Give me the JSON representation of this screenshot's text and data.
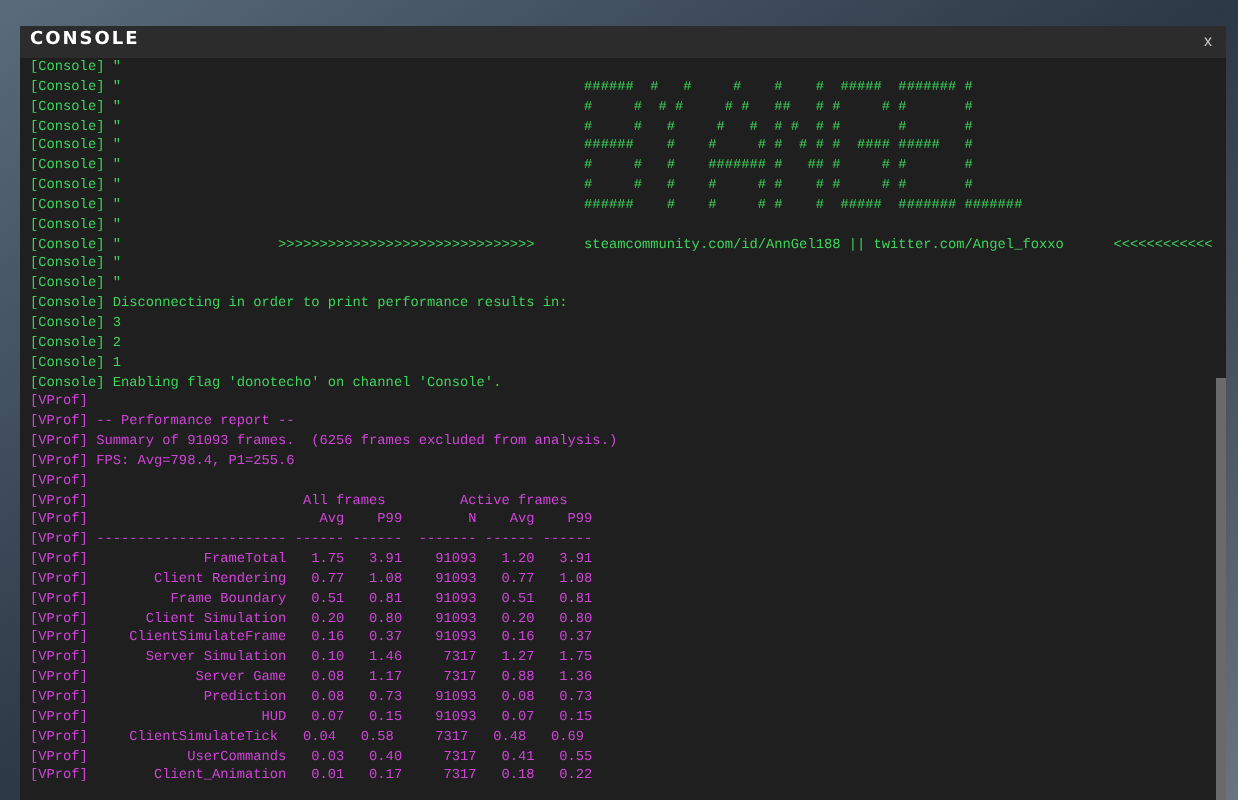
{
  "window": {
    "title": "CONSOLE",
    "close": "x"
  },
  "lines": [
    {
      "kind": "console",
      "text": "[Console] \""
    },
    {
      "kind": "console",
      "text": "[Console] \"                                                        ######  #   #     #    #    #  #####  ####### #"
    },
    {
      "kind": "console",
      "text": "[Console] \"                                                        #     #  # #     # #   ##   # #     # #       #"
    },
    {
      "kind": "console",
      "text": "[Console] \"                                                        #     #   #     #   #  # #  # #       #       #"
    },
    {
      "kind": "console",
      "text": "[Console] \"                                                        ######    #    #     # #  # # #  #### #####   #"
    },
    {
      "kind": "console",
      "text": "[Console] \"                                                        #     #   #    ####### #   ## #     # #       #"
    },
    {
      "kind": "console",
      "text": "[Console] \"                                                        #     #   #    #     # #    # #     # #       #"
    },
    {
      "kind": "console",
      "text": "[Console] \"                                                        ######    #    #     # #    #  #####  ####### #######"
    },
    {
      "kind": "console",
      "text": "[Console] \""
    },
    {
      "kind": "console",
      "text": "[Console] \"                   >>>>>>>>>>>>>>>>>>>>>>>>>>>>>>>      steamcommunity.com/id/AnnGel188 || twitter.com/Angel_foxxo      <<<<<<<<<<<<"
    },
    {
      "kind": "console",
      "text": "[Console] \""
    },
    {
      "kind": "console",
      "text": "[Console] \""
    },
    {
      "kind": "console",
      "text": "[Console] Disconnecting in order to print performance results in:"
    },
    {
      "kind": "console",
      "text": "[Console] 3"
    },
    {
      "kind": "console",
      "text": "[Console] 2"
    },
    {
      "kind": "console",
      "text": "[Console] 1"
    },
    {
      "kind": "console",
      "text": "[Console] Enabling flag 'donotecho' on channel 'Console'."
    },
    {
      "kind": "vprof",
      "text": "[VProf]"
    },
    {
      "kind": "vprof",
      "text": "[VProf] -- Performance report --"
    },
    {
      "kind": "vprof",
      "text": "[VProf] Summary of 91093 frames.  (6256 frames excluded from analysis.)"
    },
    {
      "kind": "vprof",
      "text": "[VProf] FPS: Avg=798.4, P1=255.6"
    },
    {
      "kind": "vprof",
      "text": "[VProf]"
    },
    {
      "kind": "vprof",
      "text": "[VProf]                          All frames         Active frames"
    },
    {
      "kind": "vprof",
      "text": "[VProf]                            Avg    P99        N    Avg    P99"
    },
    {
      "kind": "vprof",
      "text": "[VProf] ----------------------- ------ ------  ------- ------ ------"
    },
    {
      "kind": "vprof",
      "text": "[VProf]              FrameTotal   1.75   3.91    91093   1.20   3.91"
    },
    {
      "kind": "vprof",
      "text": "[VProf]        Client Rendering   0.77   1.08    91093   0.77   1.08"
    },
    {
      "kind": "vprof",
      "text": "[VProf]          Frame Boundary   0.51   0.81    91093   0.51   0.81"
    },
    {
      "kind": "vprof",
      "text": "[VProf]       Client Simulation   0.20   0.80    91093   0.20   0.80"
    },
    {
      "kind": "vprof",
      "text": "[VProf]     ClientSimulateFrame   0.16   0.37    91093   0.16   0.37"
    },
    {
      "kind": "vprof",
      "text": "[VProf]       Server Simulation   0.10   1.46     7317   1.27   1.75"
    },
    {
      "kind": "vprof",
      "text": "[VProf]             Server Game   0.08   1.17     7317   0.88   1.36"
    },
    {
      "kind": "vprof",
      "text": "[VProf]              Prediction   0.08   0.73    91093   0.08   0.73"
    },
    {
      "kind": "vprof",
      "text": "[VProf]                     HUD   0.07   0.15    91093   0.07   0.15"
    },
    {
      "kind": "vprof",
      "text": "[VProf]     ClientSimulateTick   0.04   0.58     7317   0.48   0.69"
    },
    {
      "kind": "vprof",
      "text": "[VProf]            UserCommands   0.03   0.40     7317   0.41   0.55"
    },
    {
      "kind": "vprof",
      "text": "[VProf]        Client_Animation   0.01   0.17     7317   0.18   0.22"
    }
  ]
}
